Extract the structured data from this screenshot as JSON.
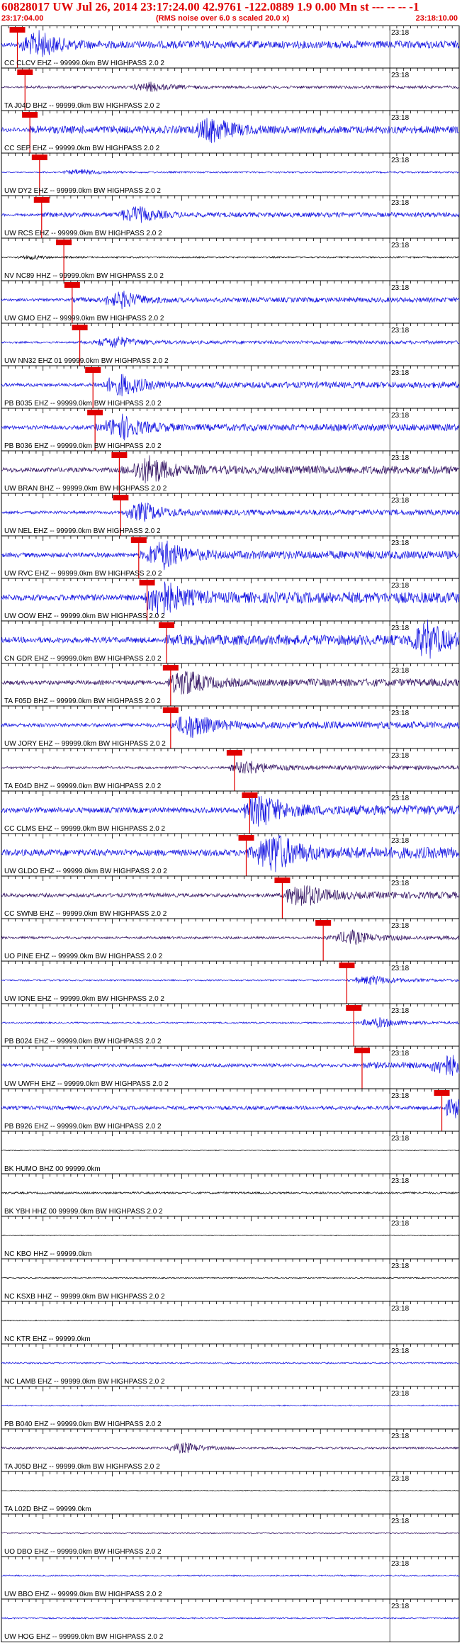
{
  "header": {
    "title": "60828017 UW Jul 26, 2014 23:17:24.00   42.9761 -122.0889  1.9 0.00 Mn st --- -- -- -1",
    "start_time": "23:17:04.00",
    "rms_note": "(RMS noise over 6.0 s scaled 20.0 x)",
    "end_time": "23:18:10.00"
  },
  "chart_data": {
    "type": "line",
    "x_axis": {
      "start": "23:17:04.00",
      "end": "23:18:10.00",
      "minute_label": "23:18"
    },
    "colors": {
      "header_text": "#e00000",
      "pick_box": "#e00000",
      "pick_line": "#e00000"
    },
    "traces": [
      {
        "label": "CC CLCV EHZ -- 99999.0km BW  HIGHPASS  2.0  2",
        "color": "#1010e0",
        "pick_time": "23:17:06.30",
        "amplitude": 0.55,
        "burst_time": "23:17:08.0"
      },
      {
        "label": "TA J04D BHZ -- 99999.0km BW  HIGHPASS  2.0  2",
        "color": "#301060",
        "pick_time": "23:17:07.40",
        "amplitude": 0.2,
        "burst_time": "23:17:24.0"
      },
      {
        "label": "CC SEP EHZ -- 99999.0km BW  HIGHPASS  2.0  2",
        "color": "#1010e0",
        "pick_time": "23:17:08.10",
        "amplitude": 0.55,
        "burst_time": "23:17:33.0"
      },
      {
        "label": "UW DY2 EHZ -- 99999.0km BW  HIGHPASS  2.0  2",
        "color": "#1010e0",
        "pick_time": "23:17:09.50",
        "amplitude": 0.12,
        "burst_time": "23:17:14.0"
      },
      {
        "label": "UW RCS EHZ -- 99999.0km BW  HIGHPASS  2.0  2",
        "color": "#1010e0",
        "pick_time": "23:17:09.80",
        "amplitude": 0.35,
        "burst_time": "23:17:22.0"
      },
      {
        "label": "NV NC89 HHZ -- 99999.0km BW  HIGHPASS  2.0  2",
        "color": "#000000",
        "pick_time": "23:17:13.00",
        "amplitude": 0.1,
        "burst_time": "23:17:07.0"
      },
      {
        "label": "UW GMO EHZ -- 99999.0km BW  HIGHPASS  2.0  2",
        "color": "#1010e0",
        "pick_time": "23:17:14.20",
        "amplitude": 0.35,
        "burst_time": "23:17:20.0"
      },
      {
        "label": "UW NN32 EHZ 01 99999.0km BW  HIGHPASS  2.0  2",
        "color": "#1010e0",
        "pick_time": "23:17:15.30",
        "amplitude": 0.25,
        "burst_time": "23:17:19.0"
      },
      {
        "label": "PB B035 EHZ -- 99999.0km BW  HIGHPASS  2.0  2",
        "color": "#1010e0",
        "pick_time": "23:17:17.20",
        "amplitude": 0.45,
        "burst_time": "23:17:20.0"
      },
      {
        "label": "PB B036 EHZ -- 99999.0km BW  HIGHPASS  2.0  2",
        "color": "#1010e0",
        "pick_time": "23:17:17.50",
        "amplitude": 0.5,
        "burst_time": "23:17:20.0"
      },
      {
        "label": "UW BRAN BHZ -- 99999.0km BW  HIGHPASS  2.0  2",
        "color": "#301060",
        "pick_time": "23:17:21.00",
        "amplitude": 0.6,
        "burst_time": "23:17:24.0"
      },
      {
        "label": "UW NEL EHZ -- 99999.0km BW  HIGHPASS  2.0  2",
        "color": "#1010e0",
        "pick_time": "23:17:21.20",
        "amplitude": 0.4,
        "burst_time": "23:17:23.0"
      },
      {
        "label": "UW RVC EHZ -- 99999.0km BW  HIGHPASS  2.0  2",
        "color": "#1010e0",
        "pick_time": "23:17:23.80",
        "amplitude": 0.6,
        "burst_time": "23:17:26.0"
      },
      {
        "label": "UW OOW EHZ -- 99999.0km BW  HIGHPASS  2.0  2",
        "color": "#1010e0",
        "pick_time": "23:17:25.00",
        "amplitude": 0.8,
        "burst_time": "23:17:25.5"
      },
      {
        "label": "CN GDR EHZ -- 99999.0km BW  HIGHPASS  2.0  2",
        "color": "#1010e0",
        "pick_time": "23:17:27.80",
        "amplitude": 0.75,
        "burst_time": "23:18:04.0"
      },
      {
        "label": "TA F05D BHZ -- 99999.0km BW  HIGHPASS  2.0  2",
        "color": "#301060",
        "pick_time": "23:17:28.40",
        "amplitude": 0.55,
        "burst_time": "23:17:29.0"
      },
      {
        "label": "UW JORY EHZ -- 99999.0km BW  HIGHPASS  2.0  2",
        "color": "#1010e0",
        "pick_time": "23:17:28.40",
        "amplitude": 0.5,
        "burst_time": "23:17:30.0"
      },
      {
        "label": "TA E04D BHZ -- 99999.0km BW  HIGHPASS  2.0  2",
        "color": "#301060",
        "pick_time": "23:17:37.60",
        "amplitude": 0.3,
        "burst_time": "23:17:38.0"
      },
      {
        "label": "CC CLMS EHZ -- 99999.0km BW  HIGHPASS  2.0  2",
        "color": "#1010e0",
        "pick_time": "23:17:39.80",
        "amplitude": 0.7,
        "burst_time": "23:17:40.0"
      },
      {
        "label": "UW GLDO EHZ -- 99999.0km BW  HIGHPASS  2.0  2",
        "color": "#1010e0",
        "pick_time": "23:17:39.30",
        "amplitude": 0.85,
        "burst_time": "23:17:42.0"
      },
      {
        "label": "CC SWNB EHZ -- 99999.0km BW  HIGHPASS  2.0  2",
        "color": "#301060",
        "pick_time": "23:17:44.50",
        "amplitude": 0.5,
        "burst_time": "23:17:46.0"
      },
      {
        "label": "UO PINE EHZ -- 99999.0km BW  HIGHPASS  2.0  2",
        "color": "#301060",
        "pick_time": "23:17:50.40",
        "amplitude": 0.3,
        "burst_time": "23:17:53.0"
      },
      {
        "label": "UW IONE EHZ -- 99999.0km BW  HIGHPASS  2.0  2",
        "color": "#1010e0",
        "pick_time": "23:17:53.80",
        "amplitude": 0.2,
        "burst_time": "23:17:56.0"
      },
      {
        "label": "PB B024 EHZ -- 99999.0km BW  HIGHPASS  2.0  2",
        "color": "#1010e0",
        "pick_time": "23:17:54.80",
        "amplitude": 0.2,
        "burst_time": "23:17:57.0"
      },
      {
        "label": "UW UWFH EHZ -- 99999.0km BW  HIGHPASS  2.0  2",
        "color": "#1010e0",
        "pick_time": "23:17:56.00",
        "amplitude": 0.45,
        "burst_time": "23:18:07.0"
      },
      {
        "label": "PB B926 EHZ -- 99999.0km BW  HIGHPASS  2.0  2",
        "color": "#1010e0",
        "pick_time": "23:18:07.50",
        "amplitude": 0.5,
        "burst_time": "23:18:09.0"
      },
      {
        "label": "BK HUMO BHZ 00 99999.0km",
        "color": "#000000",
        "pick_time": null,
        "amplitude": 0.0,
        "burst_time": null
      },
      {
        "label": "BK YBH HHZ 00 99999.0km BW  HIGHPASS  2.0  2",
        "color": "#000000",
        "pick_time": null,
        "amplitude": 0.25,
        "burst_time": null
      },
      {
        "label": "NC KBO HHZ -- 99999.0km",
        "color": "#000000",
        "pick_time": null,
        "amplitude": 0.0,
        "burst_time": null
      },
      {
        "label": "NC KSXB HHZ -- 99999.0km BW  HIGHPASS  2.0  2",
        "color": "#000000",
        "pick_time": null,
        "amplitude": 0.15,
        "burst_time": null
      },
      {
        "label": "NC KTR EHZ -- 99999.0km",
        "color": "#000000",
        "pick_time": null,
        "amplitude": 0.0,
        "burst_time": null
      },
      {
        "label": "NC LAMB EHZ -- 99999.0km BW  HIGHPASS  2.0  2",
        "color": "#1010e0",
        "pick_time": null,
        "amplitude": 0.2,
        "burst_time": null
      },
      {
        "label": "PB B040 EHZ -- 99999.0km BW  HIGHPASS  2.0  2",
        "color": "#1010e0",
        "pick_time": null,
        "amplitude": 0.15,
        "burst_time": null
      },
      {
        "label": "TA J05D BHZ -- 99999.0km BW  HIGHPASS  2.0  2",
        "color": "#301060",
        "pick_time": null,
        "amplitude": 0.25,
        "burst_time": "23:17:29.0"
      },
      {
        "label": "TA L02D BHZ -- 99999.0km",
        "color": "#000000",
        "pick_time": null,
        "amplitude": 0.0,
        "burst_time": null
      },
      {
        "label": "UO DBO EHZ -- 99999.0km BW  HIGHPASS  2.0  2",
        "color": "#301060",
        "pick_time": null,
        "amplitude": 0.12,
        "burst_time": null
      },
      {
        "label": "UW BBO EHZ -- 99999.0km BW  HIGHPASS  2.0  2",
        "color": "#1010e0",
        "pick_time": null,
        "amplitude": 0.18,
        "burst_time": null
      },
      {
        "label": "UW HOG EHZ -- 99999.0km BW  HIGHPASS  2.0  2",
        "color": "#1010e0",
        "pick_time": null,
        "amplitude": 0.18,
        "burst_time": null
      }
    ]
  }
}
